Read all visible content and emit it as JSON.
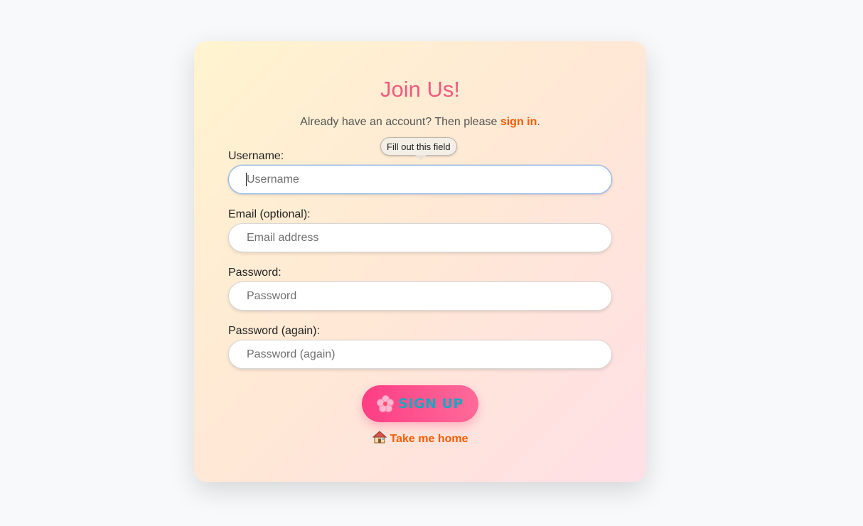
{
  "form": {
    "title": "Join Us!",
    "subtitle_prefix": "Already have an account? Then please ",
    "signin_link": "sign in",
    "subtitle_suffix": ".",
    "fields": [
      {
        "label": "Username:",
        "placeholder": "Username",
        "value": ""
      },
      {
        "label": "Email (optional):",
        "placeholder": "Email address",
        "value": ""
      },
      {
        "label": "Password:",
        "placeholder": "Password",
        "value": ""
      },
      {
        "label": "Password (again):",
        "placeholder": "Password (again)",
        "value": ""
      }
    ],
    "validation_tooltip": "Fill out this field",
    "signup_label": "SIGN UP",
    "signup_icon": "cherry-blossom-icon",
    "home_label": "Take me home",
    "home_icon": "house-icon"
  },
  "colors": {
    "page_background": "#f8f9fb",
    "title": "#f2597f",
    "link": "#ff5a00",
    "button_gradient_start": "#ff3d84",
    "button_gradient_end": "#ff6a9a",
    "button_text": "#19a7be",
    "focus_border": "#8fb6e8"
  }
}
